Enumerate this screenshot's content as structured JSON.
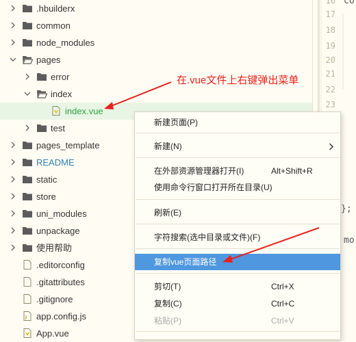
{
  "tree": {
    "items": [
      {
        "label": ".hbuilderx",
        "kind": "folder",
        "expanded": false
      },
      {
        "label": "common",
        "kind": "folder",
        "expanded": false
      },
      {
        "label": "node_modules",
        "kind": "folder",
        "expanded": false
      },
      {
        "label": "pages",
        "kind": "folder",
        "expanded": true
      },
      {
        "label": "error",
        "kind": "folder",
        "expanded": false
      },
      {
        "label": "index",
        "kind": "folder",
        "expanded": true
      },
      {
        "label": "index.vue",
        "kind": "vue-file",
        "selected": true
      },
      {
        "label": "test",
        "kind": "folder",
        "expanded": false
      },
      {
        "label": "pages_template",
        "kind": "folder",
        "expanded": false
      },
      {
        "label": "README",
        "kind": "folder",
        "expanded": false
      },
      {
        "label": "static",
        "kind": "folder",
        "expanded": false
      },
      {
        "label": "store",
        "kind": "folder",
        "expanded": false
      },
      {
        "label": "uni_modules",
        "kind": "folder",
        "expanded": false
      },
      {
        "label": "unpackage",
        "kind": "folder",
        "expanded": false
      },
      {
        "label": "使用帮助",
        "kind": "folder",
        "expanded": false
      },
      {
        "label": ".editorconfig",
        "kind": "file"
      },
      {
        "label": ".gitattributes",
        "kind": "file"
      },
      {
        "label": ".gitignore",
        "kind": "file"
      },
      {
        "label": "app.config.js",
        "kind": "js-file"
      },
      {
        "label": "App.vue",
        "kind": "vue-file"
      }
    ]
  },
  "editor": {
    "line_numbers": [
      "16",
      "17",
      "18",
      "19",
      "20",
      "21",
      "22",
      "23"
    ],
    "code_fragments": {
      "top": "co",
      "mid": "};",
      "low": "mo"
    }
  },
  "context_menu": {
    "items": [
      {
        "label": "新建页面(P)",
        "shortcut": ""
      },
      {
        "label": "新建(N)",
        "shortcut": "",
        "submenu": true
      },
      {
        "label": "在外部资源管理器打开(I)",
        "shortcut": "Alt+Shift+R"
      },
      {
        "label": "使用命令行窗口打开所在目录(U)",
        "shortcut": ""
      },
      {
        "label": "刷新(E)",
        "shortcut": ""
      },
      {
        "label": "字符搜索(选中目录或文件)(F)",
        "shortcut": ""
      },
      {
        "label": "复制vue页面路径",
        "shortcut": "",
        "highlighted": true
      },
      {
        "label": "剪切(T)",
        "shortcut": "Ctrl+X"
      },
      {
        "label": "复制(C)",
        "shortcut": "Ctrl+C"
      },
      {
        "label": "粘贴(P)",
        "shortcut": "Ctrl+V",
        "disabled": true
      }
    ]
  },
  "annotation": {
    "text": "在.vue文件上右键弹出菜单",
    "color": "#e8211c"
  },
  "colors": {
    "accent": "#4f97de",
    "selected_text": "#2aa53d",
    "folder": "#5c5c5c",
    "background": "#fffdf3"
  }
}
